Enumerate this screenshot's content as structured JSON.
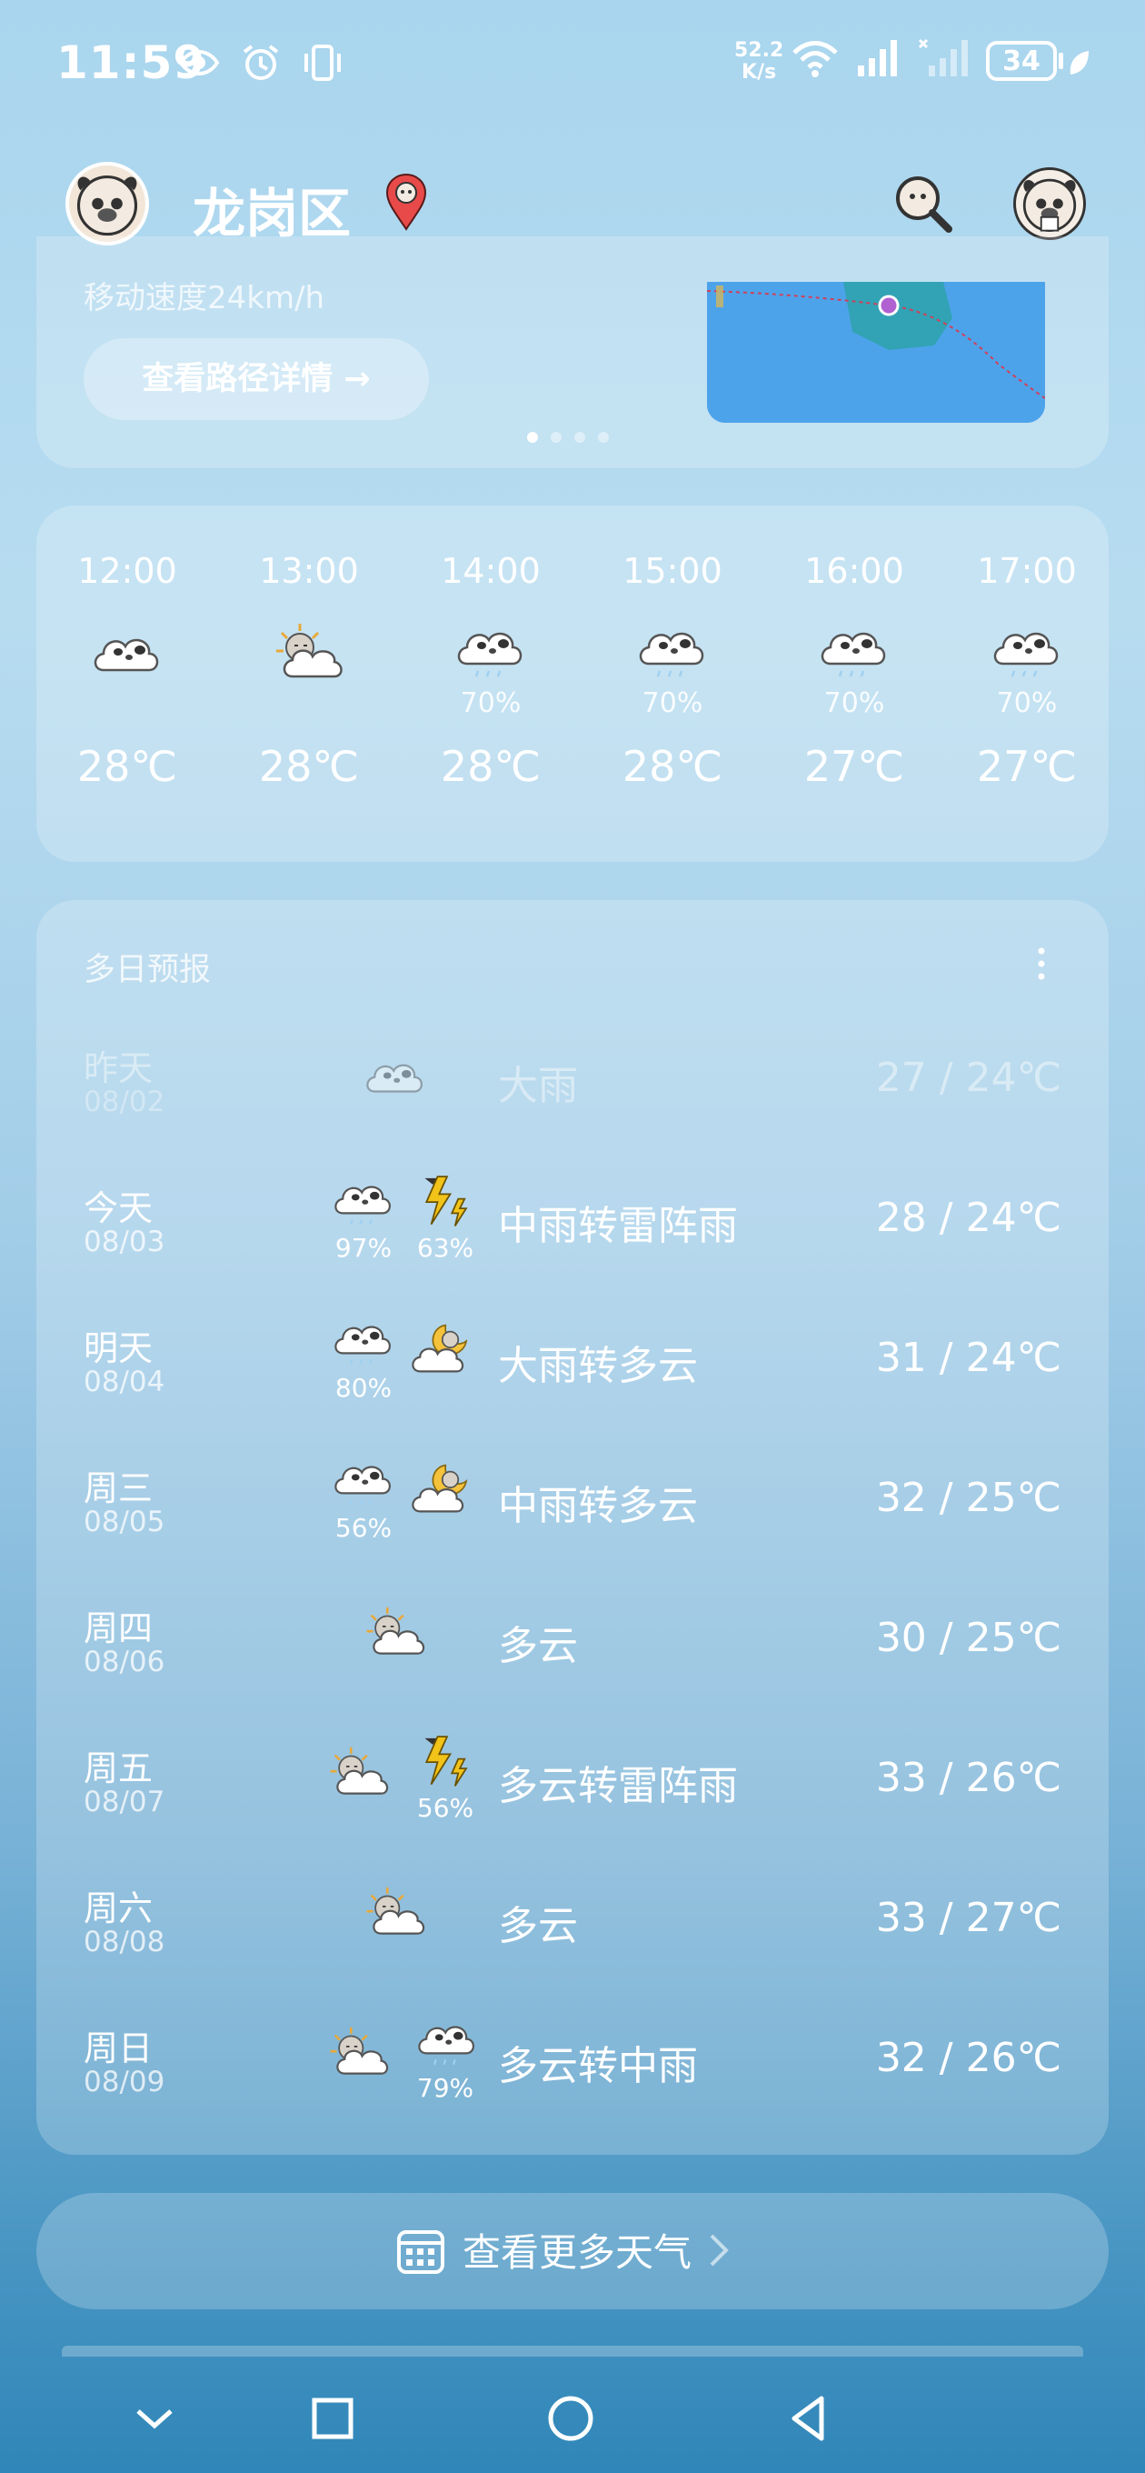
{
  "status_bar": {
    "time": "11:59",
    "net_speed_value": "52.2",
    "net_speed_unit": "K/s",
    "battery": "34",
    "icons": [
      "eye-icon",
      "alarm-icon",
      "vibrate-icon",
      "wifi-icon",
      "signal-icon",
      "signal-x-icon",
      "battery-icon",
      "leaf-icon"
    ]
  },
  "header": {
    "city": "龙岗区",
    "icons": [
      "avatar-icon",
      "location-pin-icon",
      "search-icon",
      "menu-icon"
    ]
  },
  "typhoon_card": {
    "speed_text": "移动速度24km/h",
    "route_button": "查看路径详情 →",
    "page_count": 4,
    "active_page": 1
  },
  "hourly": [
    {
      "time": "12:00",
      "icon": "cloudy-icon",
      "pct": "",
      "temp": "28℃"
    },
    {
      "time": "13:00",
      "icon": "partly-cloudy-icon",
      "pct": "",
      "temp": "28℃"
    },
    {
      "time": "14:00",
      "icon": "rain-icon",
      "pct": "70%",
      "temp": "28℃"
    },
    {
      "time": "15:00",
      "icon": "rain-icon",
      "pct": "70%",
      "temp": "28℃"
    },
    {
      "time": "16:00",
      "icon": "rain-icon",
      "pct": "70%",
      "temp": "27℃"
    },
    {
      "time": "17:00",
      "icon": "rain-icon",
      "pct": "70%",
      "temp": "27℃"
    }
  ],
  "daily": {
    "title": "多日预报",
    "rows": [
      {
        "day": "昨天",
        "date": "08/02",
        "icons": [
          "heavy-rain-icon"
        ],
        "pcts": [
          ""
        ],
        "desc": "大雨",
        "temp": "27 / 24℃",
        "faded": true
      },
      {
        "day": "今天",
        "date": "08/03",
        "icons": [
          "rain-icon",
          "thunder-icon"
        ],
        "pcts": [
          "97%",
          "63%"
        ],
        "desc": "中雨转雷阵雨",
        "temp": "28 / 24℃",
        "faded": false
      },
      {
        "day": "明天",
        "date": "08/04",
        "icons": [
          "rain-icon",
          "moon-cloud-icon"
        ],
        "pcts": [
          "80%",
          ""
        ],
        "desc": "大雨转多云",
        "temp": "31 / 24℃",
        "faded": false
      },
      {
        "day": "周三",
        "date": "08/05",
        "icons": [
          "rain-icon",
          "moon-cloud-icon"
        ],
        "pcts": [
          "56%",
          ""
        ],
        "desc": "中雨转多云",
        "temp": "32 / 25℃",
        "faded": false
      },
      {
        "day": "周四",
        "date": "08/06",
        "icons": [
          "partly-cloudy-icon"
        ],
        "pcts": [
          ""
        ],
        "desc": "多云",
        "temp": "30 / 25℃",
        "faded": false
      },
      {
        "day": "周五",
        "date": "08/07",
        "icons": [
          "partly-cloudy-icon",
          "thunder-icon"
        ],
        "pcts": [
          "",
          "56%"
        ],
        "desc": "多云转雷阵雨",
        "temp": "33 / 26℃",
        "faded": false
      },
      {
        "day": "周六",
        "date": "08/08",
        "icons": [
          "partly-cloudy-icon"
        ],
        "pcts": [
          ""
        ],
        "desc": "多云",
        "temp": "33 / 27℃",
        "faded": false
      },
      {
        "day": "周日",
        "date": "08/09",
        "icons": [
          "partly-cloudy-icon",
          "rain-icon"
        ],
        "pcts": [
          "",
          "79%"
        ],
        "desc": "多云转中雨",
        "temp": "32 / 26℃",
        "faded": false
      }
    ]
  },
  "more_button": {
    "label": "查看更多天气"
  },
  "nav_icons": [
    "chevron-down-icon",
    "recent-apps-icon",
    "home-icon",
    "back-icon"
  ],
  "colors": {
    "map_blue": "#4da3ea",
    "typhoon_track": "#d0405a",
    "sun_yellow": "#f5c33b",
    "bolt_yellow": "#f2c318"
  }
}
